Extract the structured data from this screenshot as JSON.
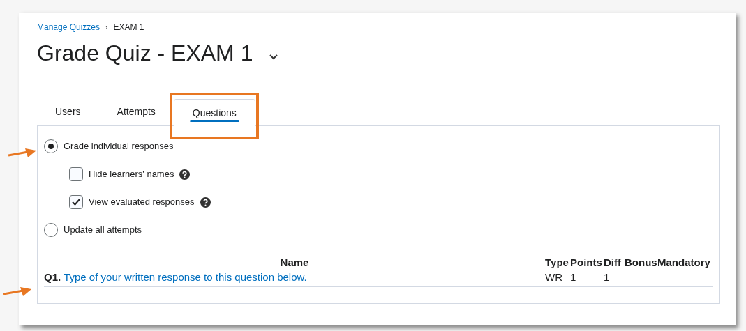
{
  "breadcrumb": [
    {
      "label": "Manage Quizzes",
      "kind": "link"
    },
    {
      "label": "EXAM 1",
      "kind": "current",
      "separator": "›"
    }
  ],
  "title": "Grade Quiz - EXAM 1",
  "tabs": [
    {
      "label": "Users",
      "selected": false
    },
    {
      "label": "Attempts",
      "selected": false
    },
    {
      "label": "Questions",
      "selected": true
    }
  ],
  "options": [
    {
      "kind": "radio",
      "label": "Grade individual responses",
      "selected": true
    },
    {
      "kind": "checkbox",
      "label": "Hide learners' names",
      "checked": false,
      "help": true
    },
    {
      "kind": "checkbox",
      "label": "View evaluated responses",
      "checked": true,
      "help": true
    },
    {
      "kind": "radio",
      "label": "Update all attempts",
      "selected": false
    }
  ],
  "table": {
    "columns": [
      "Name",
      "Type",
      "Points",
      "Diff",
      "Bonus",
      "Mandatory"
    ],
    "rows": [
      {
        "name": {
          "number": "Q1.",
          "title": "Type of your written response to this question below."
        },
        "type": "WR",
        "points": "1",
        "diff": "1"
      }
    ]
  }
}
